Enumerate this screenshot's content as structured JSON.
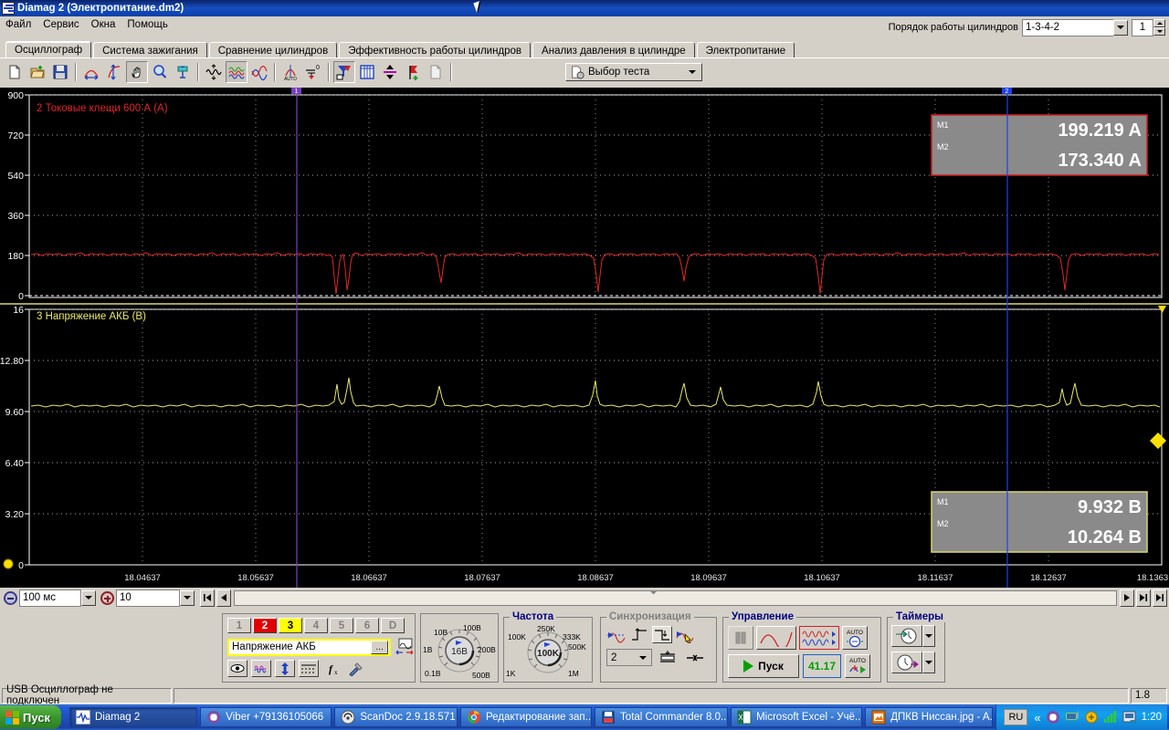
{
  "window": {
    "title": "Diamag 2 (Электропитание.dm2)",
    "icon": "waveform-icon"
  },
  "menu": {
    "items": [
      "Файл",
      "Сервис",
      "Окна",
      "Помощь"
    ]
  },
  "cylinder_order": {
    "label": "Порядок работы цилиндров",
    "selected": "1-3-4-2",
    "count": "1"
  },
  "tabs": [
    {
      "label": "Осциллограф",
      "active": true
    },
    {
      "label": "Система зажигания",
      "active": false
    },
    {
      "label": "Сравнение цилиндров",
      "active": false
    },
    {
      "label": "Эффективность работы цилиндров",
      "active": false
    },
    {
      "label": "Анализ давления в цилиндре",
      "active": false
    },
    {
      "label": "Электропитание",
      "active": false
    }
  ],
  "toolbar": {
    "test_select_label": "Выбор теста",
    "buttons": [
      "new-document-icon",
      "open-folder-icon",
      "save-disk-icon",
      "measure-width-icon",
      "measure-height-icon",
      "hand-pan-icon",
      "zoom-magnifier-icon",
      "vertical-scale-icon",
      "waveform-black-icon",
      "waveform-multi-icon",
      "waveform-pair-icon",
      "auto-measure-icon",
      "zero-level-icon",
      "filter-icon",
      "grid-icon",
      "divide-icon",
      "marker-flag-icon",
      "page-icon"
    ]
  },
  "scope": {
    "channels": [
      {
        "id": "2",
        "label": "2 Токовые клещи 600 А (А)",
        "color": "#e03030",
        "y_ticks": [
          "900",
          "720",
          "540",
          "360",
          "180",
          "0"
        ],
        "y_max": 900,
        "y_min": 0,
        "baseline": 185,
        "measure": {
          "m1_label": "M1",
          "m1_value": "199.219 A",
          "m2_label": "M2",
          "m2_value": "173.340 A",
          "border_color": "#d02020"
        }
      },
      {
        "id": "3",
        "label": "3 Напряжение АКБ (В)",
        "color": "#e8e870",
        "y_ticks": [
          "16",
          "12.80",
          "9.60",
          "6.40",
          "3.20",
          "0"
        ],
        "y_max": 16,
        "y_min": 0,
        "baseline": 9.85,
        "measure": {
          "m1_label": "M1",
          "m1_value": "9.932 B",
          "m2_label": "M2",
          "m2_value": "10.264 B",
          "border_color": "#d8d870"
        }
      }
    ],
    "x_ticks": [
      "18.04637",
      "18.05637",
      "18.06637",
      "18.07637",
      "18.08637",
      "18.09637",
      "18.10637",
      "18.11637",
      "18.12637",
      "18.1363"
    ],
    "cursors": [
      {
        "name": "1",
        "color": "#8040c0",
        "x_pct": 25.4
      },
      {
        "name": "2",
        "color": "#2040e0",
        "x_pct": 86.2
      }
    ]
  },
  "timebase": {
    "scale_value": "100 мс",
    "divisions_value": "10"
  },
  "panel": {
    "channel_buttons": [
      {
        "label": "1",
        "state": "off"
      },
      {
        "label": "2",
        "state": "red"
      },
      {
        "label": "3",
        "state": "yellow"
      },
      {
        "label": "4",
        "state": "off"
      },
      {
        "label": "5",
        "state": "off"
      },
      {
        "label": "6",
        "state": "off"
      },
      {
        "label": "D",
        "state": "off"
      }
    ],
    "channel_name": "Напряжение АКБ",
    "channel_name_more": "...",
    "voltage_knob": {
      "center": "16В",
      "ticks": [
        "0.1В",
        "1В",
        "10В",
        "100В",
        "200В",
        "500В"
      ]
    },
    "frequency": {
      "title": "Частота",
      "center": "100K",
      "ticks": [
        "1K",
        "100K",
        "250K",
        "333K",
        "500K",
        "1M"
      ]
    },
    "sync": {
      "title": "Синхронизация",
      "channel": "2"
    },
    "control": {
      "title": "Управление",
      "start_label": "Пуск",
      "freq_value": "41.17",
      "auto_label": "AUTO"
    },
    "timers": {
      "title": "Таймеры"
    }
  },
  "statusbar": {
    "message": "USB Осциллограф не подключен",
    "right_value": "1.8"
  },
  "taskbar": {
    "start_label": "Пуск",
    "items": [
      {
        "label": "Diamag 2",
        "icon": "waveform-icon",
        "active": true
      },
      {
        "label": "Viber +79136105066",
        "icon": "viber-icon",
        "active": false
      },
      {
        "label": "ScanDoc 2.9.18.571",
        "icon": "scandoc-icon",
        "active": false
      },
      {
        "label": "Редактирование зап...",
        "icon": "chrome-icon",
        "active": false
      },
      {
        "label": "Total Commander 8.0...",
        "icon": "commander-icon",
        "active": false
      },
      {
        "label": "Microsoft Excel - Учё...",
        "icon": "excel-icon",
        "active": false
      },
      {
        "label": "ДПКВ Ниссан.jpg - A...",
        "icon": "image-icon",
        "active": false
      }
    ],
    "language": "RU",
    "clock": "1:20",
    "tray_icons": [
      "chevron-left-icon",
      "viber-icon",
      "network-icon",
      "antivirus-icon",
      "signal-icon",
      "update-icon"
    ]
  }
}
